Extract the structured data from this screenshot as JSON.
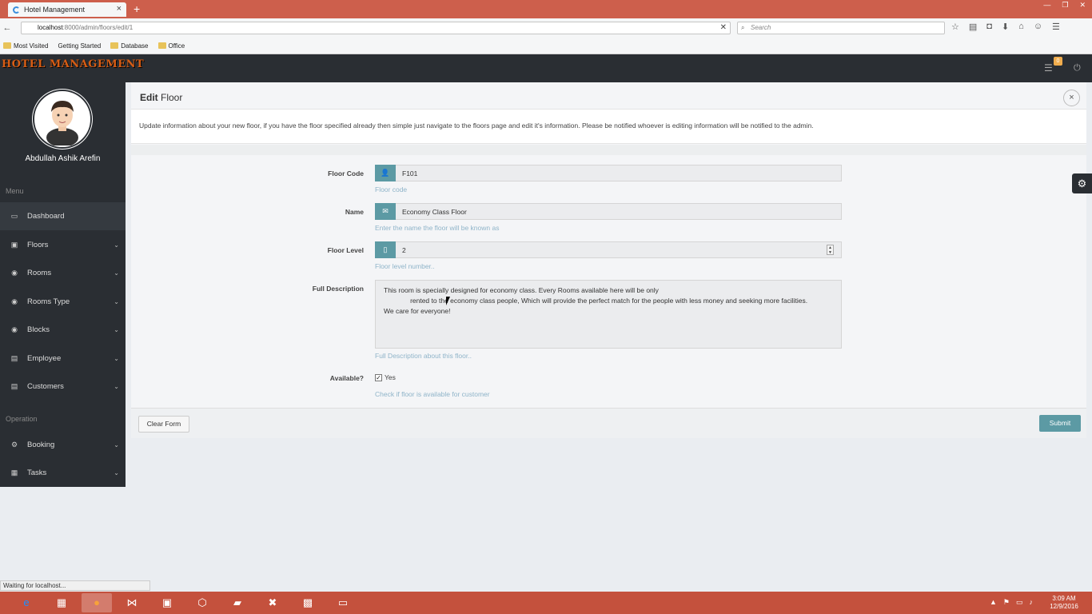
{
  "browser": {
    "tab_title": "Hotel Management",
    "new_tab": "+",
    "tab_close": "×",
    "url_host": "localhost",
    "url_path": ":8000/admin/floors/edit/1",
    "search_placeholder": "Search",
    "bookmarks": [
      "Most Visited",
      "Getting Started",
      "Database",
      "Office"
    ],
    "status": "Waiting for localhost..."
  },
  "app": {
    "logo": "HOTEL MANAGEMENT",
    "notification_count": "0"
  },
  "sidebar": {
    "user_name": "Abdullah Ashik Arefin",
    "menu_heading": "Menu",
    "operation_heading": "Operation",
    "menu_items": [
      {
        "label": "Dashboard",
        "icon": "monitor-icon"
      },
      {
        "label": "Floors",
        "icon": "floors-icon"
      },
      {
        "label": "Rooms",
        "icon": "rooms-icon"
      },
      {
        "label": "Rooms Type",
        "icon": "room-type-icon"
      },
      {
        "label": "Blocks",
        "icon": "blocks-icon"
      },
      {
        "label": "Employee",
        "icon": "employee-icon"
      },
      {
        "label": "Customers",
        "icon": "customers-icon"
      }
    ],
    "operation_items": [
      {
        "label": "Booking",
        "icon": "booking-icon"
      },
      {
        "label": "Tasks",
        "icon": "tasks-icon"
      }
    ]
  },
  "panel": {
    "title_bold": "Edit",
    "title_rest": "Floor",
    "description": "Update information about your new floor, if you have the floor specified already then simple just navigate to the floors page and edit it's information. Please be notified whoever is editing information will be notified to the admin."
  },
  "form": {
    "floor_code": {
      "label": "Floor Code",
      "value": "F101",
      "help": "Floor code"
    },
    "name": {
      "label": "Name",
      "value": "Economy Class Floor",
      "help": "Enter the name the floor will be known as"
    },
    "floor_level": {
      "label": "Floor Level",
      "value": "2",
      "help": "Floor level number.."
    },
    "full_description": {
      "label": "Full Description",
      "value": "This room is specially designed for economy class. Every Rooms available here will be only\n              rented to the economy class people, Which will provide the perfect match for the people with less money and seeking more facilities.\nWe care for everyone!",
      "help": "Full Description about this floor.."
    },
    "available": {
      "label": "Available?",
      "option": "Yes",
      "checked": true,
      "help": "Check if floor is available for customer"
    },
    "clear_label": "Clear Form",
    "submit_label": "Submit"
  },
  "taskbar": {
    "time": "3:09 AM",
    "date": "12/9/2016"
  }
}
